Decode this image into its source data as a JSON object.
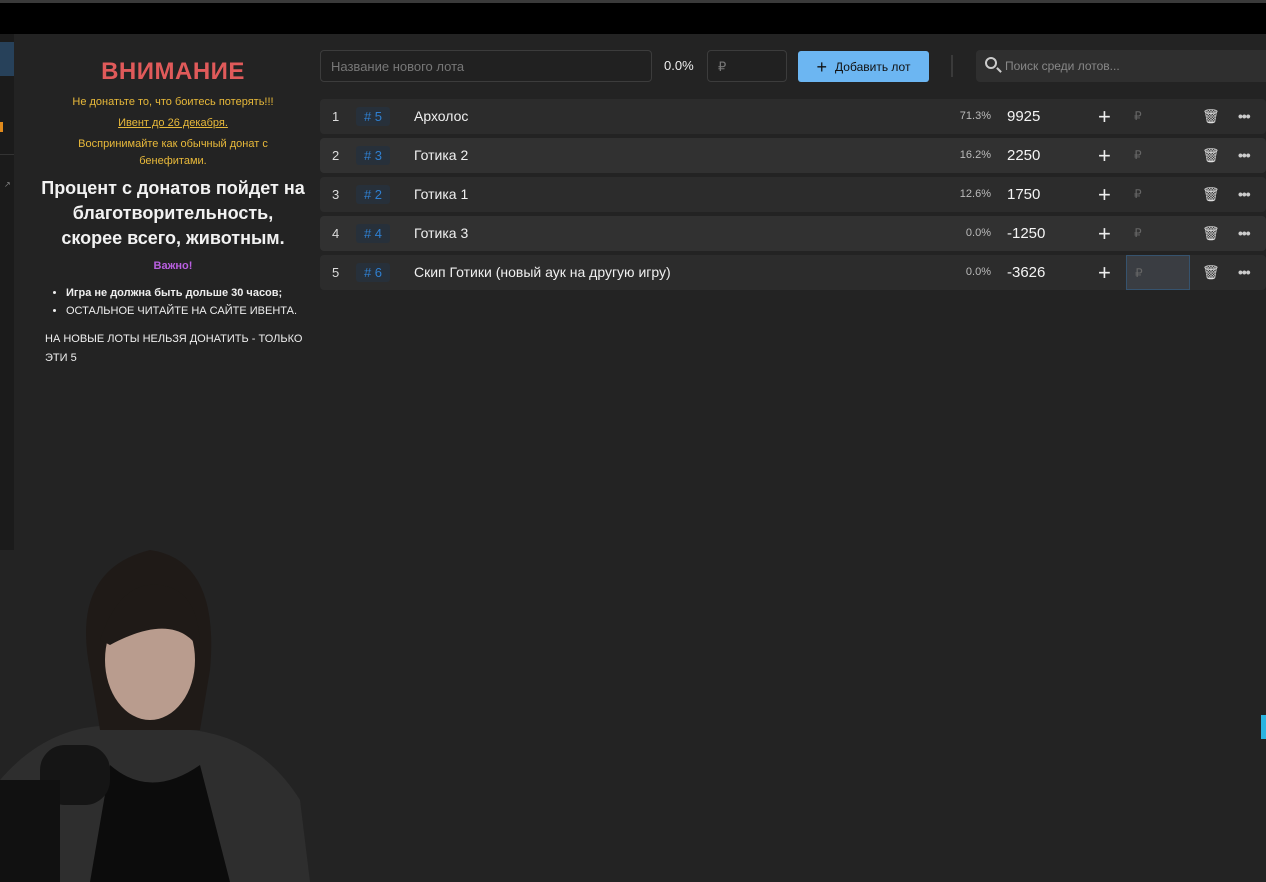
{
  "notice": {
    "title": "ВНИМАНИЕ",
    "line1": "Не донатьте то, что боитесь потерять!!!",
    "event_link": "Ивент до 26 декабря.",
    "line3": "Воспринимайте как обычный донат с бенефитами.",
    "big": "Процент с донатов пойдет на благотворительность, скорее всего, животным.",
    "important": "Важно!",
    "rules": [
      "Игра не должна быть дольше 30 часов;",
      "ОСТАЛЬНОЕ ЧИТАЙТЕ НА САЙТЕ ИВЕНТА."
    ],
    "footer": "НА НОВЫЕ ЛОТЫ НЕЛЬЗЯ ДОНАТИТЬ - ТОЛЬКО ЭТИ 5"
  },
  "toolbar": {
    "name_placeholder": "Название нового лота",
    "percent": "0.0%",
    "amount_placeholder": "₽",
    "add_label": "Добавить лот",
    "search_placeholder": "Поиск среди лотов..."
  },
  "lots": [
    {
      "index": "1",
      "id": "# 5",
      "name": "Архолос",
      "percent": "71.3%",
      "amount": "9925",
      "currency": "₽"
    },
    {
      "index": "2",
      "id": "# 3",
      "name": "Готика 2",
      "percent": "16.2%",
      "amount": "2250",
      "currency": "₽"
    },
    {
      "index": "3",
      "id": "# 2",
      "name": "Готика 1",
      "percent": "12.6%",
      "amount": "1750",
      "currency": "₽"
    },
    {
      "index": "4",
      "id": "# 4",
      "name": "Готика 3",
      "percent": "0.0%",
      "amount": "-1250",
      "currency": "₽"
    },
    {
      "index": "5",
      "id": "# 6",
      "name": "Скип Готики (новый аук на другую игру)",
      "percent": "0.0%",
      "amount": "-3626",
      "currency": "₽"
    }
  ],
  "colors": {
    "accent": "#6cb6f2",
    "warning_title": "#e05a5a",
    "notice_text": "#e8b93a",
    "important": "#b95fe0",
    "lot_id": "#2f7fd0"
  }
}
